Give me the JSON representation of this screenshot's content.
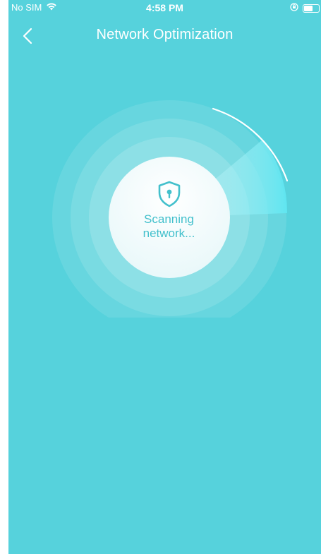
{
  "status_bar": {
    "carrier": "No SIM",
    "time": "4:58 PM",
    "icons": [
      "wifi-icon",
      "orientation-lock-icon",
      "battery-icon"
    ]
  },
  "nav": {
    "title": "Network Optimization",
    "back_icon": "chevron-left-icon"
  },
  "scan": {
    "status_line_1": "Scanning",
    "status_line_2": "network...",
    "icon": "shield-keyhole-icon"
  },
  "colors": {
    "background": "#56d2dc",
    "accent": "#43c0cc",
    "white": "#ffffff"
  }
}
